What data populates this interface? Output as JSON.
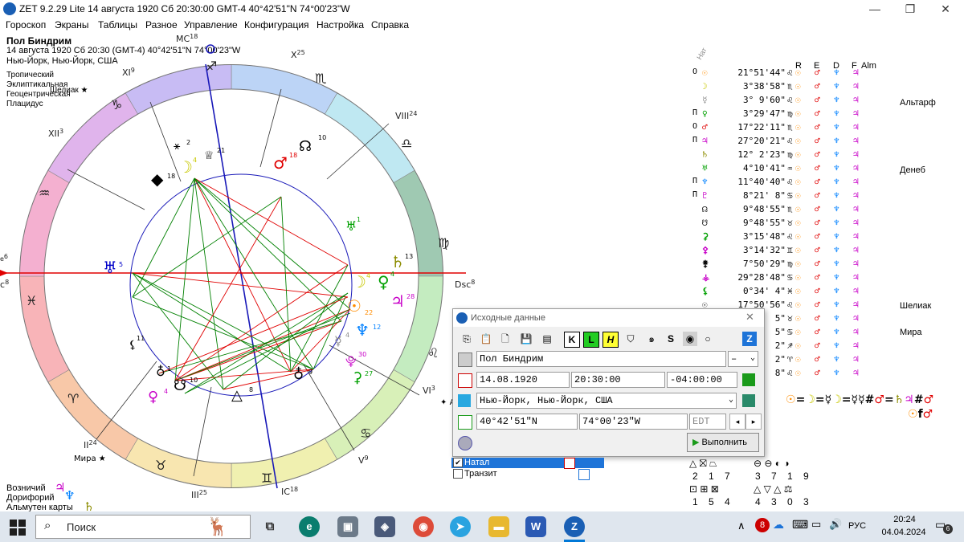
{
  "window": {
    "title": "ZET 9.2.29 Lite   14 августа 1920  Сб  20:30:00 GMT-4 40°42'51\"N  74°00'23\"W",
    "minimize": "—",
    "maximize": "❐",
    "close": "✕"
  },
  "menu": [
    "Гороскоп",
    "Экраны",
    "Таблицы",
    "Разное",
    "Управление",
    "Конфигурация",
    "Настройка",
    "Справка"
  ],
  "info": {
    "name": "Пол Биндрим",
    "date_line": "14 августа 1920  Сб  20:30 (GMT-4) 40°42'51\"N  74°00'23\"W",
    "place": "Нью-Йорк, Нью-Йорк, США",
    "zodiac": "Тропический",
    "plane": "Эклиптикальная",
    "center": "Геоцентрическая",
    "houses": "Плацидус",
    "sheliak": "Шелиак"
  },
  "chart": {
    "mc": "MC",
    "mc_deg": "18",
    "ic": "IC",
    "ic_deg": "18",
    "dsc": "Dsc",
    "dsc_deg": "8",
    "asc_left": "c",
    "asc_deg": "8",
    "asc_deg2": "6",
    "houses": [
      {
        "label": "XI",
        "deg": "9"
      },
      {
        "label": "X",
        "deg": "25"
      },
      {
        "label": "XII",
        "deg": "3"
      },
      {
        "label": "VIII",
        "deg": "24"
      },
      {
        "label": "II",
        "deg": "24"
      },
      {
        "label": "III",
        "deg": "25"
      },
      {
        "label": "VI",
        "deg": "3"
      },
      {
        "label": "V",
        "deg": "9"
      }
    ],
    "planet_degs": [
      "18",
      "10",
      "13",
      "1",
      "22",
      "4",
      "4",
      "28",
      "12",
      "4",
      "30",
      "27",
      "9",
      "8",
      "10",
      "5",
      "11",
      "4",
      "1",
      "2",
      "4",
      "21",
      "18"
    ],
    "star_mira": "Мира",
    "star_alm": "Ал"
  },
  "bottom_left": {
    "vozn_label": "Возничий",
    "dorif_label": "Дорифорий",
    "almuten_label": "Альмутен карты"
  },
  "table": {
    "headers": [
      "Нат",
      "R",
      "E",
      "D",
      "F",
      "Alm"
    ],
    "rows": [
      {
        "pre": "О",
        "deg": "21°51'44\""
      },
      {
        "pre": "",
        "deg": "3°38'58\""
      },
      {
        "pre": "",
        "deg": "3° 9'60\""
      },
      {
        "pre": "П",
        "deg": "3°29'47\""
      },
      {
        "pre": "О",
        "deg": "17°22'11\""
      },
      {
        "pre": "П",
        "deg": "27°20'21\""
      },
      {
        "pre": "",
        "deg": "12° 2'23\""
      },
      {
        "pre": "",
        "deg": "4°10'41\""
      },
      {
        "pre": "П",
        "deg": "11°40'40\""
      },
      {
        "pre": "П",
        "deg": "8°21' 8\""
      },
      {
        "pre": "",
        "deg": "9°48'55\""
      },
      {
        "pre": "",
        "deg": "9°48'55\""
      },
      {
        "pre": "",
        "deg": "3°15'48\""
      },
      {
        "pre": "",
        "deg": "3°14'32\""
      },
      {
        "pre": "",
        "deg": "7°50'29\""
      },
      {
        "pre": "",
        "deg": "29°28'48\""
      },
      {
        "pre": "",
        "deg": "0°34' 4\""
      },
      {
        "pre": "",
        "deg": "17°50'56\""
      },
      {
        "pre": "",
        "deg": "5\""
      },
      {
        "pre": "",
        "deg": "5\""
      },
      {
        "pre": "",
        "deg": "2\""
      },
      {
        "pre": "",
        "deg": "2\""
      },
      {
        "pre": "",
        "deg": "8\""
      }
    ],
    "stars": [
      "Альтарф",
      "Денеб",
      "Шелиак",
      "Мира"
    ]
  },
  "dialog": {
    "title": "Исходные данные",
    "name_value": "Пол Биндрим",
    "gender_value": "–",
    "date_value": "14.08.1920",
    "time_value": "20:30:00",
    "tz_value": "-04:00:00",
    "place_value": "Нью-Йорк, Нью-Йорк, США",
    "lat_value": "40°42'51\"N",
    "lon_value": "74°00'23\"W",
    "zone_value": "EDT",
    "run_label": "Выполнить"
  },
  "chart_list": [
    {
      "label": "Натал",
      "checked": true
    },
    {
      "label": "Транзит",
      "checked": false
    }
  ],
  "aspect_grid": {
    "row1_nums": [
      "2",
      "1",
      "7"
    ],
    "row1b_nums": [
      "3",
      "7",
      "1",
      "9"
    ],
    "row2_nums": [
      "1",
      "5",
      "4"
    ],
    "row2b_nums": [
      "4",
      "3",
      "0",
      "3"
    ]
  },
  "taskbar": {
    "search_placeholder": "Поиск",
    "lang": "РУС",
    "time": "20:24",
    "date": "04.04.2024",
    "notif_count": "6"
  },
  "colors": {
    "sun": "#ff8c00",
    "moon": "#c8c800",
    "mercury": "#8c8c8c",
    "venus": "#00a000",
    "mars": "#e00000",
    "jupiter": "#c800c8",
    "saturn": "#8c8c00",
    "uranus": "#00a000",
    "neptune": "#0080ff",
    "pluto": "#c800c8",
    "aspect_green": "#008000",
    "aspect_red": "#e00000",
    "house_blue": "#0000c8",
    "accent": "#0078d7"
  }
}
